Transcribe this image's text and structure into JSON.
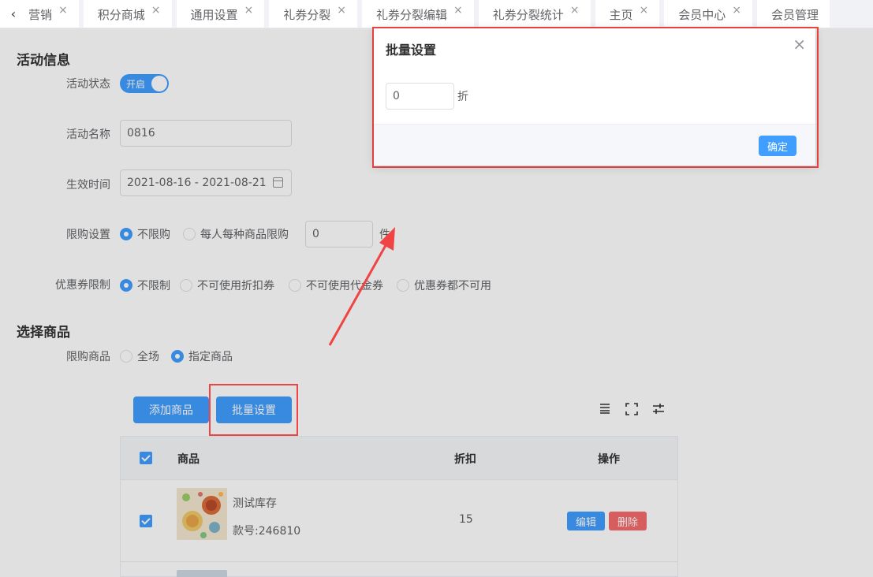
{
  "tabs": [
    {
      "label": "营销"
    },
    {
      "label": "积分商城"
    },
    {
      "label": "通用设置"
    },
    {
      "label": "礼券分裂"
    },
    {
      "label": "礼券分裂编辑"
    },
    {
      "label": "礼券分裂统计"
    },
    {
      "label": "主页"
    },
    {
      "label": "会员中心"
    },
    {
      "label": "会员管理"
    }
  ],
  "activity": {
    "section_title": "活动信息",
    "status_label": "活动状态",
    "status_switch_text": "开启",
    "name_label": "活动名称",
    "name_value": "0816",
    "time_label": "生效时间",
    "time_value": "2021-08-16 - 2021-08-21",
    "limit_label": "限购设置",
    "limit_opt_none": "不限购",
    "limit_opt_each": "每人每种商品限购",
    "limit_qty": "0",
    "limit_unit": "件",
    "coupon_label": "优惠券限制",
    "coupon_opts": [
      "不限制",
      "不可使用折扣券",
      "不可使用代金券",
      "优惠券都不可用"
    ]
  },
  "goods": {
    "section_title": "选择商品",
    "scope_label": "限购商品",
    "scope_all": "全场",
    "scope_specified": "指定商品",
    "add_button": "添加商品",
    "batch_button": "批量设置",
    "toolbar_icons": [
      "density-icon",
      "fullscreen-icon",
      "column-settings-icon"
    ],
    "table": {
      "headers": {
        "product": "商品",
        "discount": "折扣",
        "actions": "操作"
      },
      "rows": [
        {
          "name": "测试库存",
          "code": "款号:246810",
          "discount": "15",
          "edit": "编辑",
          "delete": "删除"
        }
      ]
    }
  },
  "dialog": {
    "title": "批量设置",
    "input_value": "0",
    "unit": "折",
    "confirm": "确定"
  },
  "colors": {
    "primary": "#409eff",
    "danger": "#f56c6c",
    "annotation": "#f04444"
  }
}
